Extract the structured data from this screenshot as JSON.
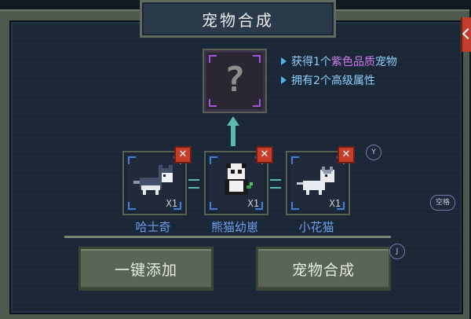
{
  "title": "宠物合成",
  "result": {
    "placeholder_glyph": "?",
    "rarity_color": "#a055d8"
  },
  "info": {
    "line1_prefix": "获得1个",
    "line1_highlight": "紫色品质",
    "line1_suffix": "宠物",
    "line2": "拥有2个高级属性"
  },
  "pets": [
    {
      "name": "哈士奇",
      "count": "X1",
      "remove": "✕"
    },
    {
      "name": "熊猫幼崽",
      "count": "X1",
      "remove": "✕"
    },
    {
      "name": "小花猫",
      "count": "X1",
      "remove": "✕"
    }
  ],
  "buttons": {
    "auto_add": "一键添加",
    "combine": "宠物合成"
  },
  "hints": {
    "y": "Y",
    "space": "空格",
    "j": "J"
  },
  "colors": {
    "accent_purple": "#d07af0",
    "info_blue": "#8fd0ff",
    "slot_corner_blue": "#3d7fd9",
    "remove_red": "#c63e2a"
  }
}
